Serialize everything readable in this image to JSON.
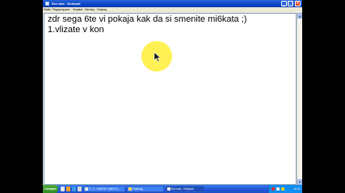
{
  "window": {
    "title": "Без име - Notepad",
    "minimize_glyph": "_",
    "maximize_glyph": "□",
    "close_glyph": "x"
  },
  "menu": {
    "items": [
      "Файл",
      "Редактиране",
      "Формат",
      "Изглед",
      "Помощ"
    ]
  },
  "editor": {
    "lines": [
      "zdr sega 6te vi pokaja kak da si smenite mi6kata ;)",
      " 1.vlizate v kon"
    ]
  },
  "scrollbar": {
    "up_glyph": "▲",
    "down_glyph": "▼"
  },
  "taskbar": {
    "start_label": "Старт",
    "buttons": [
      {
        "label": "3 - 1 - 1498 BY CyBrY D...",
        "icon": "video-app-icon"
      },
      {
        "label": "Flashing",
        "icon": "folder-icon"
      },
      {
        "label": "Без име - Notepad",
        "icon": "notepad-icon"
      }
    ],
    "clock": "16:22"
  },
  "colors": {
    "titlebar": "#0a46c8",
    "cursor_highlight": "#ffee3c",
    "taskbar": "#2458d8",
    "start_button": "#2f8b22"
  }
}
